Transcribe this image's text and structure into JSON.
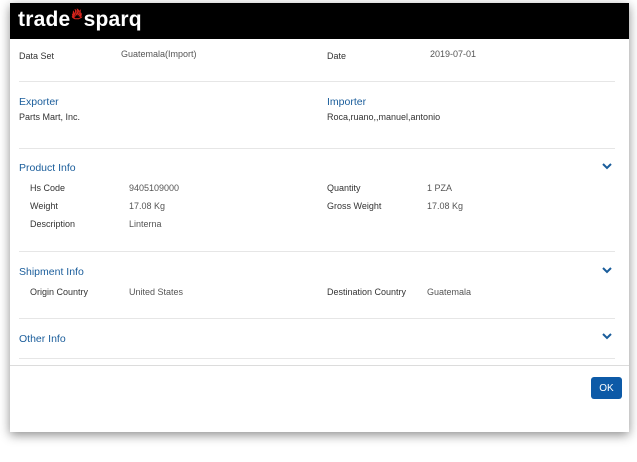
{
  "brand": {
    "part1": "trade",
    "part2": "sparq"
  },
  "overview": {
    "dataset_label": "Data Set",
    "dataset_value": "Guatemala(Import)",
    "date_label": "Date",
    "date_value": "2019-07-01"
  },
  "exporter": {
    "title": "Exporter",
    "name": "Parts Mart, Inc."
  },
  "importer": {
    "title": "Importer",
    "name": "Roca,ruano,,manuel,antonio"
  },
  "product": {
    "title": "Product Info",
    "hs_label": "Hs Code",
    "hs_value": "9405109000",
    "quantity_label": "Quantity",
    "quantity_value": "1 PZA",
    "weight_label": "Weight",
    "weight_value": "17.08 Kg",
    "gross_label": "Gross Weight",
    "gross_value": "17.08 Kg",
    "desc_label": "Description",
    "desc_value": "Linterna"
  },
  "shipment": {
    "title": "Shipment Info",
    "origin_label": "Origin Country",
    "origin_value": "United States",
    "dest_label": "Destination Country",
    "dest_value": "Guatemala"
  },
  "other": {
    "title": "Other Info"
  },
  "footer": {
    "ok_label": "OK"
  },
  "colors": {
    "accent": "#1a5d9b",
    "button": "#0d5aa7",
    "header": "#000000"
  }
}
